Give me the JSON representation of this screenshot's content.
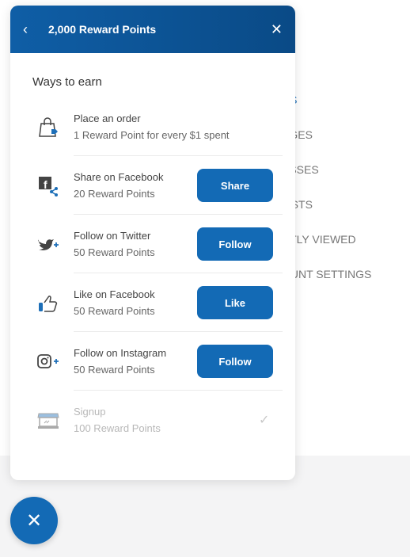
{
  "background_nav": [
    "RS",
    "AGES",
    "ESSES",
    "LISTS",
    "NTLY VIEWED",
    "OUNT SETTINGS"
  ],
  "header": {
    "title": "2,000 Reward Points",
    "back_icon": "chevron-left-icon",
    "close_icon": "close-icon"
  },
  "section_title": "Ways to earn",
  "items": [
    {
      "title": "Place an order",
      "points": "1 Reward Point for every $1 spent",
      "icon": "shopping-bag-icon"
    },
    {
      "title": "Share on Facebook",
      "points": "20 Reward Points",
      "button": "Share",
      "icon": "facebook-share-icon"
    },
    {
      "title": "Follow on Twitter",
      "points": "50 Reward Points",
      "button": "Follow",
      "icon": "twitter-follow-icon"
    },
    {
      "title": "Like on Facebook",
      "points": "50 Reward Points",
      "button": "Like",
      "icon": "thumbs-up-icon"
    },
    {
      "title": "Follow on Instagram",
      "points": "50 Reward Points",
      "button": "Follow",
      "icon": "instagram-follow-icon"
    },
    {
      "title": "Signup",
      "points": "100 Reward Points",
      "icon": "store-icon",
      "completed": true
    }
  ],
  "colors": {
    "accent": "#136ab5",
    "header": "#0f5ea6"
  },
  "fab_icon": "close-icon"
}
